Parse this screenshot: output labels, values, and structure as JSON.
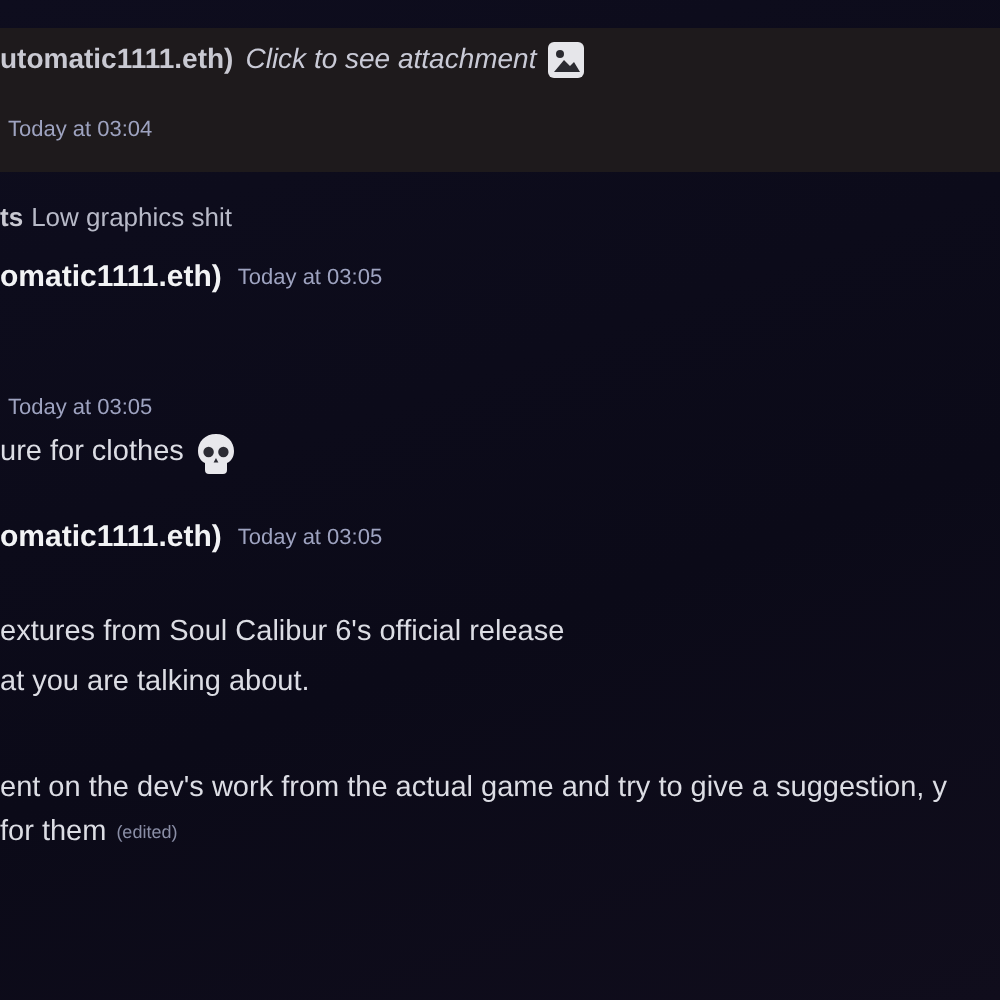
{
  "messages": [
    {
      "kind": "highlighted",
      "author": "utomatic1111.eth)",
      "text": "Click to see attachment",
      "attachment_icon": true,
      "timestamp": "Today at 03:04"
    },
    {
      "kind": "reply_preview",
      "author": "ts",
      "text": "Low graphics shit"
    },
    {
      "kind": "header",
      "author": "omatic1111.eth)",
      "timestamp": "Today at 03:05"
    },
    {
      "kind": "timestamp",
      "timestamp": "Today at 03:05"
    },
    {
      "kind": "text",
      "text": "ure for clothes",
      "skull_emoji": true
    },
    {
      "kind": "header",
      "author": "omatic1111.eth)",
      "timestamp": "Today at 03:05"
    },
    {
      "kind": "text",
      "text": "extures from Soul Calibur 6's official release"
    },
    {
      "kind": "text",
      "text": "at you are talking about."
    },
    {
      "kind": "text",
      "text": "ent on the dev's work from the actual game and try to give a suggestion, y"
    },
    {
      "kind": "text",
      "text": "for them",
      "edited": "(edited)"
    }
  ]
}
